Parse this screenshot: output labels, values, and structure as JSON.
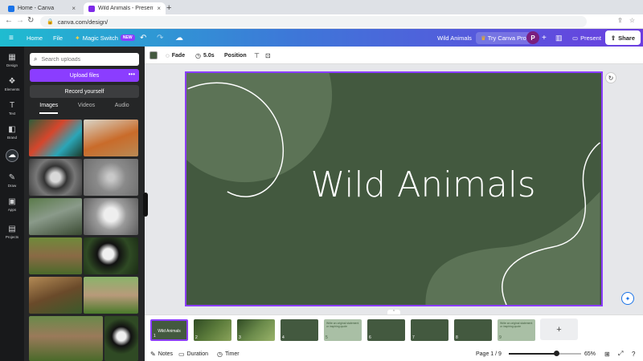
{
  "browser": {
    "tabs": [
      {
        "title": "Home - Canva",
        "close_icon": "×"
      },
      {
        "title": "Wild Animals - Presentation",
        "close_icon": "×"
      }
    ],
    "new_tab_icon": "+",
    "url": "canva.com/design/"
  },
  "header": {
    "menu_icon": "≡",
    "home": "Home",
    "file": "File",
    "magic_switch": "Magic Switch",
    "new_badge": "NEW",
    "undo_icon": "↶",
    "redo_icon": "↷",
    "cloud_icon": "☁",
    "design_name": "Wild Animals",
    "try_pro": "Try Canva Pro",
    "avatar_initial": "P",
    "add_icon": "+",
    "insights_icon": "▥",
    "present": "Present",
    "share": "Share"
  },
  "rail": [
    {
      "icon": "▦",
      "label": "Design"
    },
    {
      "icon": "❖",
      "label": "Elements"
    },
    {
      "icon": "T",
      "label": "Text"
    },
    {
      "icon": "◧",
      "label": "Brand"
    },
    {
      "icon": "☁",
      "label": "Uploads",
      "active": true
    },
    {
      "icon": "✎",
      "label": "Draw"
    },
    {
      "icon": "▣",
      "label": "Apps"
    },
    {
      "icon": "▤",
      "label": "Projects"
    }
  ],
  "uploads": {
    "search_placeholder": "Search uploads",
    "upload_files": "Upload files",
    "more_icon": "•••",
    "record_yourself": "Record yourself",
    "tabs": [
      "Images",
      "Videos",
      "Audio"
    ],
    "images": [
      {
        "name": "chameleon"
      },
      {
        "name": "fox"
      },
      {
        "name": "raccoon"
      },
      {
        "name": "squirrel"
      },
      {
        "name": "wolf"
      },
      {
        "name": "cat"
      },
      {
        "name": "donkey"
      },
      {
        "name": "panda"
      },
      {
        "name": "deer"
      },
      {
        "name": "rabbit"
      },
      {
        "name": "donkey-large"
      },
      {
        "name": "panda-small"
      }
    ]
  },
  "toolbar": {
    "fade": "Fade",
    "duration": "5.0s",
    "position": "Position"
  },
  "slide": {
    "title": "Wild Animals",
    "background": "#43593f"
  },
  "pages": [
    {
      "num": "1",
      "title": "Wild Animals",
      "active": true
    },
    {
      "num": "2"
    },
    {
      "num": "3"
    },
    {
      "num": "4"
    },
    {
      "num": "5",
      "text": "Write an original statement or inspiring quote"
    },
    {
      "num": "6"
    },
    {
      "num": "7"
    },
    {
      "num": "8"
    },
    {
      "num": "9",
      "text": "Write an original statement or inspiring quote"
    }
  ],
  "bottom": {
    "notes": "Notes",
    "duration": "Duration",
    "timer": "Timer",
    "page_indicator": "Page 1 / 9",
    "zoom": "65%",
    "zoom_level": 0.65
  },
  "colors": {
    "accent": "#8b3dff",
    "slide_green": "#43593f"
  }
}
